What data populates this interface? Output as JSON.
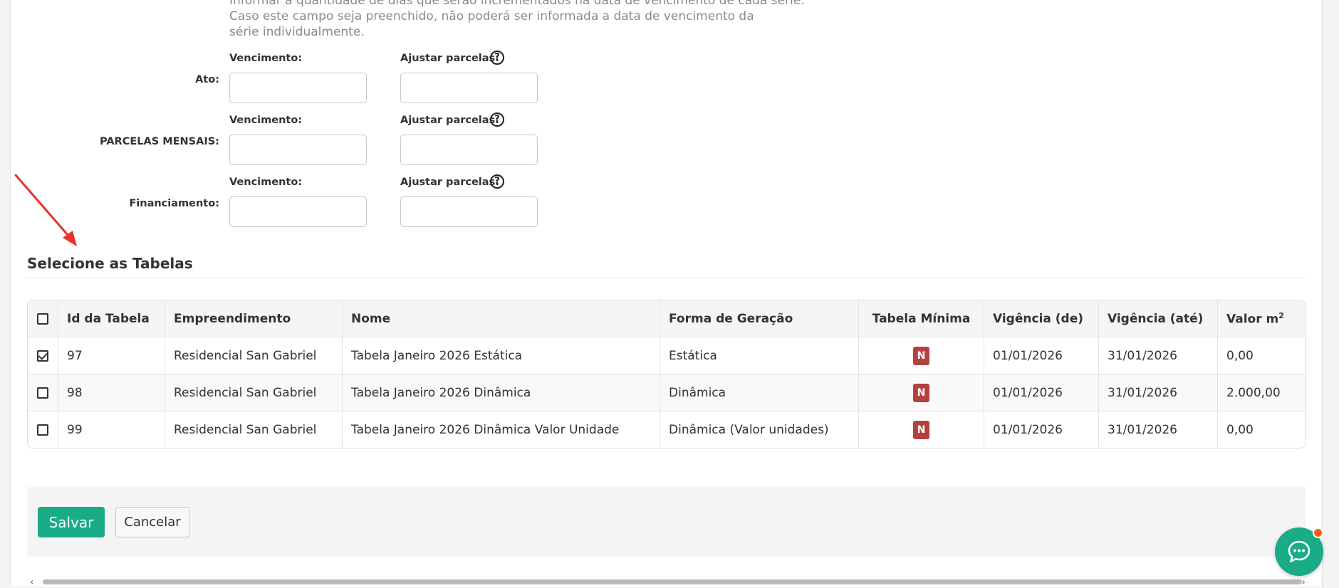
{
  "hint": {
    "line1": "Informar a quantidade de dias que serão incrementados na data de vencimento de cada série.",
    "line2": "Caso este campo seja preenchido, não poderá ser informada a data de vencimento da",
    "line3": "série individualmente."
  },
  "installments": [
    {
      "label": "Ato:",
      "due_label": "Vencimento:",
      "adjust_label": "Ajustar parcelas:",
      "due_value": "",
      "adjust_value": ""
    },
    {
      "label": "PARCELAS MENSAIS:",
      "due_label": "Vencimento:",
      "adjust_label": "Ajustar parcelas:",
      "due_value": "",
      "adjust_value": ""
    },
    {
      "label": "Financiamento:",
      "due_label": "Vencimento:",
      "adjust_label": "Ajustar parcelas:",
      "due_value": "",
      "adjust_value": ""
    }
  ],
  "help_glyph": "?",
  "section_title": "Selecione as Tabelas",
  "table": {
    "headers": {
      "id": "Id da Tabela",
      "empreendimento": "Empreendimento",
      "nome": "Nome",
      "forma": "Forma de Geração",
      "minima": "Tabela Mínima",
      "de": "Vigência (de)",
      "ate": "Vigência (até)",
      "valor": "Valor m",
      "valor_sup": "2"
    },
    "rows": [
      {
        "checked": true,
        "id": "97",
        "empreendimento": "Residencial San Gabriel",
        "nome": "Tabela Janeiro 2026 Estática",
        "forma": "Estática",
        "minima": "N",
        "de": "01/01/2026",
        "ate": "31/01/2026",
        "valor": "0,00"
      },
      {
        "checked": false,
        "id": "98",
        "empreendimento": "Residencial San Gabriel",
        "nome": "Tabela Janeiro 2026 Dinâmica",
        "forma": "Dinâmica",
        "minima": "N",
        "de": "01/01/2026",
        "ate": "31/01/2026",
        "valor": "2.000,00"
      },
      {
        "checked": false,
        "id": "99",
        "empreendimento": "Residencial San Gabriel",
        "nome": "Tabela Janeiro 2026 Dinâmica Valor Unidade",
        "forma": "Dinâmica (Valor unidades)",
        "minima": "N",
        "de": "01/01/2026",
        "ate": "31/01/2026",
        "valor": "0,00"
      }
    ]
  },
  "buttons": {
    "save": "Salvar",
    "cancel": "Cancelar"
  },
  "scroll": {
    "left": "‹",
    "right": "›"
  },
  "colors": {
    "accent": "#1aab87",
    "badge": "#b5413f",
    "arrow": "#e8322b",
    "notify": "#ff5a1f"
  },
  "icons": {
    "help": "question-circle-icon",
    "chat": "chat-bubble-icon",
    "arrow": "red-annotation-arrow"
  }
}
